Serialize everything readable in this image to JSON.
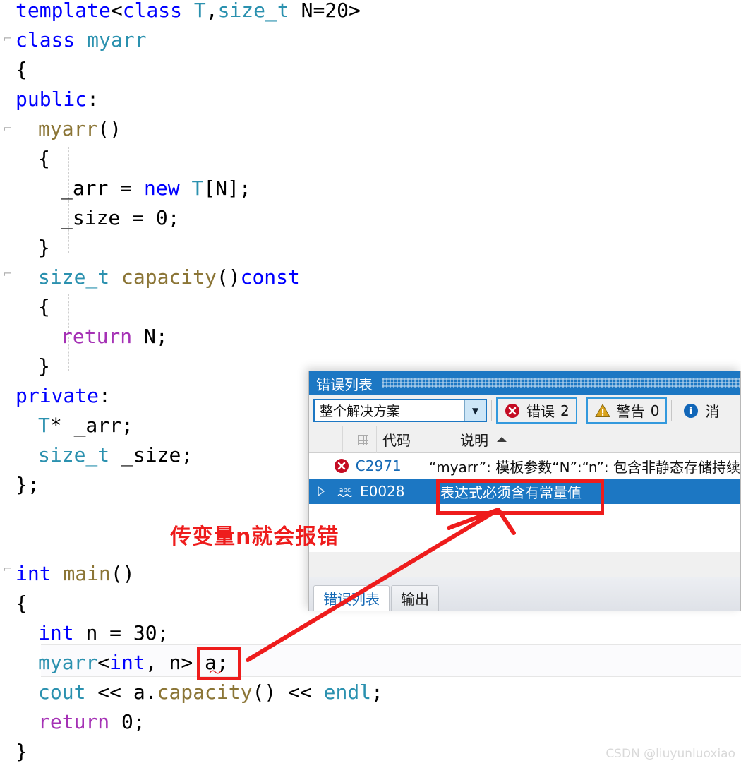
{
  "editor": {
    "language": "cpp",
    "lines": [
      {
        "indent": 0,
        "text": "template<class T,size_t N=20>"
      },
      {
        "indent": 0,
        "text": "class myarr"
      },
      {
        "indent": 0,
        "text": "{"
      },
      {
        "indent": 0,
        "text": "public:"
      },
      {
        "indent": 1,
        "text": "myarr()"
      },
      {
        "indent": 1,
        "text": "{"
      },
      {
        "indent": 2,
        "text": "_arr = new T[N];"
      },
      {
        "indent": 2,
        "text": "_size = 0;"
      },
      {
        "indent": 1,
        "text": "}"
      },
      {
        "indent": 1,
        "text": "size_t capacity()const"
      },
      {
        "indent": 1,
        "text": "{"
      },
      {
        "indent": 2,
        "text": "return N;"
      },
      {
        "indent": 1,
        "text": "}"
      },
      {
        "indent": 0,
        "text": "private:"
      },
      {
        "indent": 1,
        "text": "T* _arr;"
      },
      {
        "indent": 1,
        "text": "size_t _size;"
      },
      {
        "indent": 0,
        "text": "};"
      },
      {
        "indent": 0,
        "text": ""
      },
      {
        "indent": 0,
        "text": ""
      },
      {
        "indent": 0,
        "text": "int main()"
      },
      {
        "indent": 0,
        "text": "{"
      },
      {
        "indent": 1,
        "text": "int n = 30;"
      },
      {
        "indent": 1,
        "text": "myarr<int, n> a;"
      },
      {
        "indent": 1,
        "text": "cout << a.capacity() << endl;"
      },
      {
        "indent": 1,
        "text": "return 0;"
      },
      {
        "indent": 0,
        "text": "}"
      }
    ],
    "error_token": "n>",
    "squiggle_glyph": "〜"
  },
  "error_list": {
    "title": "错误列表",
    "scope_filter": {
      "value": "整个解决方案",
      "dropdown_icon": "chevron-down-icon"
    },
    "counters": [
      {
        "icon": "error-icon",
        "label": "错误",
        "count": "2"
      },
      {
        "icon": "warning-icon",
        "label": "警告",
        "count": "0"
      },
      {
        "icon": "info-icon",
        "label": "消",
        "count": ""
      }
    ],
    "columns": [
      {
        "key": "expander",
        "label": ""
      },
      {
        "key": "icon",
        "label": ""
      },
      {
        "key": "code",
        "label": "代码"
      },
      {
        "key": "description",
        "label": "说明",
        "sort": "asc",
        "sort_icon": "sort-asc-icon"
      }
    ],
    "rows": [
      {
        "expander": "",
        "icon": "error-icon",
        "code": "C2971",
        "description": "“myarr”: 模板参数“N”:“n”: 包含非静态存储持续",
        "selected": false
      },
      {
        "expander": "triangle-right-icon",
        "icon": "abc-squiggle-icon",
        "code": "E0028",
        "description": "表达式必须含有常量值",
        "selected": true
      }
    ],
    "tabs": [
      {
        "label": "错误列表",
        "active": true
      },
      {
        "label": "输出",
        "active": false
      }
    ]
  },
  "annotations": {
    "note_text": "传变量n就会报错",
    "note_color": "#ee1c1c",
    "arrow_color": "#ee1c1c",
    "highlight_box_color": "#ee1c1c"
  },
  "watermark": {
    "text": "CSDN @liuyunluoxiao"
  },
  "colors": {
    "keyword": "#0000ff",
    "type": "#2b91af",
    "function": "#8b7536",
    "control": "#a531b5",
    "plain": "#000000",
    "panel_title_bg": "#1c77c3",
    "selection_bg": "#1c77c3",
    "code_link": "#1569b5"
  }
}
